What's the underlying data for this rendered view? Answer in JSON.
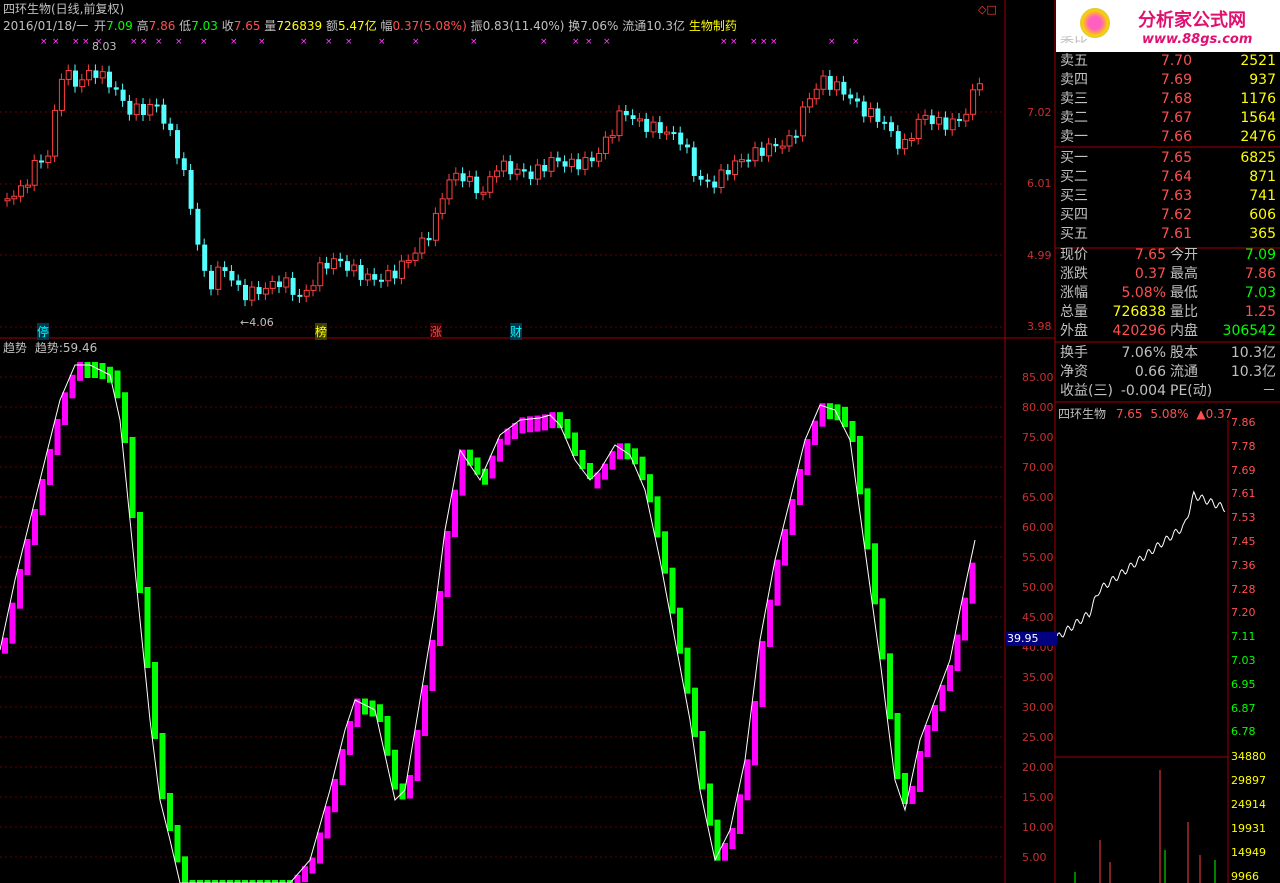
{
  "header": {
    "title": "四环生物(日线,前复权)",
    "date": "2016/01/18/一",
    "open_label": "开",
    "open": "7.09",
    "high_label": "高",
    "high": "7.86",
    "low_label": "低",
    "low": "7.03",
    "close_label": "收",
    "close": "7.65",
    "vol_label": "量",
    "vol": "726839",
    "amt_label": "额",
    "amt": "5.47亿",
    "chg_label": "幅",
    "chg": "0.37(5.08%)",
    "amp_label": "振",
    "amp": "0.83(11.40%)",
    "turn_label": "换",
    "turn": "7.06%",
    "float_label": "流通",
    "float": "10.3亿",
    "industry": "生物制药",
    "price_hi_mark": "8.03",
    "price_lo_mark": "←4.06"
  },
  "price_axis": [
    "7.02",
    "6.01",
    "4.99",
    "3.98"
  ],
  "markers": {
    "m1": "停",
    "m2": "榜",
    "m3": "涨",
    "m4": "财"
  },
  "indicator": {
    "name": "趋势",
    "label": "趋势:",
    "value": "59.46",
    "cursor_value": "39.95",
    "axis": [
      "85.00",
      "80.00",
      "75.00",
      "70.00",
      "65.00",
      "60.00",
      "55.00",
      "50.00",
      "45.00",
      "40.00",
      "35.00",
      "30.00",
      "25.00",
      "20.00",
      "15.00",
      "10.00",
      "5.00"
    ]
  },
  "logo": {
    "name": "分析家公式网",
    "url": "www.88gs.com"
  },
  "orderbook": {
    "ask_partial_label": "委比",
    "asks": [
      {
        "label": "卖五",
        "price": "7.70",
        "vol": "2521"
      },
      {
        "label": "卖四",
        "price": "7.69",
        "vol": "937"
      },
      {
        "label": "卖三",
        "price": "7.68",
        "vol": "1176"
      },
      {
        "label": "卖二",
        "price": "7.67",
        "vol": "1564"
      },
      {
        "label": "卖一",
        "price": "7.66",
        "vol": "2476"
      }
    ],
    "bids": [
      {
        "label": "买一",
        "price": "7.65",
        "vol": "6825"
      },
      {
        "label": "买二",
        "price": "7.64",
        "vol": "871"
      },
      {
        "label": "买三",
        "price": "7.63",
        "vol": "741"
      },
      {
        "label": "买四",
        "price": "7.62",
        "vol": "606"
      },
      {
        "label": "买五",
        "price": "7.61",
        "vol": "365"
      }
    ]
  },
  "stats": [
    {
      "l1": "现价",
      "v1": "7.65",
      "l2": "今开",
      "v2": "7.09"
    },
    {
      "l1": "涨跌",
      "v1": "0.37",
      "l2": "最高",
      "v2": "7.86"
    },
    {
      "l1": "涨幅",
      "v1": "5.08%",
      "l2": "最低",
      "v2": "7.03"
    },
    {
      "l1": "总量",
      "v1": "726838",
      "l2": "量比",
      "v2": "1.25"
    },
    {
      "l1": "外盘",
      "v1": "420296",
      "l2": "内盘",
      "v2": "306542"
    }
  ],
  "fund": [
    {
      "l1": "换手",
      "v1": "7.06%",
      "l2": "股本",
      "v2": "10.3亿"
    },
    {
      "l1": "净资",
      "v1": "0.66",
      "l2": "流通",
      "v2": "10.3亿"
    },
    {
      "l1": "收益(三)",
      "v1": "-0.004",
      "l2": "PE(动)",
      "v2": "－"
    }
  ],
  "mini": {
    "name": "四环生物",
    "price": "7.65",
    "pct": "5.08%",
    "chg": "▲0.37",
    "price_axis": [
      "7.86",
      "7.78",
      "7.69",
      "7.61",
      "7.53",
      "7.45",
      "7.36",
      "7.28",
      "7.20",
      "7.11",
      "7.03",
      "6.95",
      "6.87",
      "6.78"
    ],
    "vol_axis": [
      "34880",
      "29897",
      "24914",
      "19931",
      "14949",
      "9966"
    ]
  },
  "colors": {
    "up": "#ff4040",
    "down": "#54ffff",
    "magenta": "#ff00ff",
    "green": "#00ff00",
    "grid": "#8b0000"
  }
}
